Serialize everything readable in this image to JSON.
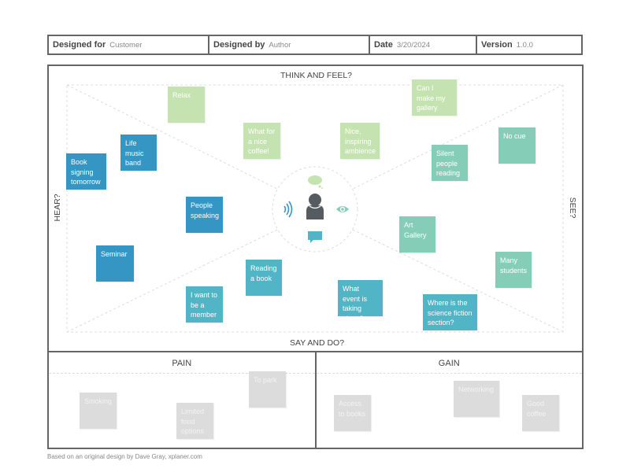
{
  "header": {
    "designed_for": {
      "label": "Designed for",
      "value": "Customer"
    },
    "designed_by": {
      "label": "Designed by",
      "value": "Author"
    },
    "date": {
      "label": "Date",
      "value": "3/20/2024"
    },
    "version": {
      "label": "Version",
      "value": "1.0.0"
    }
  },
  "sections": {
    "think_feel": "THINK AND FEEL?",
    "hear": "HEAR?",
    "see": "SEE?",
    "say_do": "SAY AND DO?",
    "pain": "PAIN",
    "gain": "GAIN"
  },
  "center_icons": [
    "thought-bubble-icon",
    "sound-waves-icon",
    "person-icon",
    "eye-icon",
    "speech-bubble-icon"
  ],
  "colors": {
    "think_feel": "#c5e3b0",
    "see": "#86cdb8",
    "hear": "#3595c3",
    "say_do": "#52b5c6",
    "pain_gain": "#dcdcdc"
  },
  "notes": {
    "think_feel": [
      "Relax",
      "What for a nice coffee!",
      "Nice, inspiring ambience",
      "Can I make my gallery event here?"
    ],
    "see": [
      "No cue",
      "Silent people reading",
      "Art Gallery",
      "Many students"
    ],
    "hear": [
      "Book signing tomorrow",
      "Life music band",
      "People speaking",
      "Seminar"
    ],
    "say_do": [
      "Reading a book",
      "I want to be a member",
      "What event is taking place?",
      "Where is the science fiction section?"
    ],
    "pain": [
      "Smoking",
      "Limited food options",
      "To park"
    ],
    "gain": [
      "Access to books",
      "Networking",
      "Good coffee"
    ]
  },
  "footer": "Based on an original design by Dave Gray, xplaner.com"
}
